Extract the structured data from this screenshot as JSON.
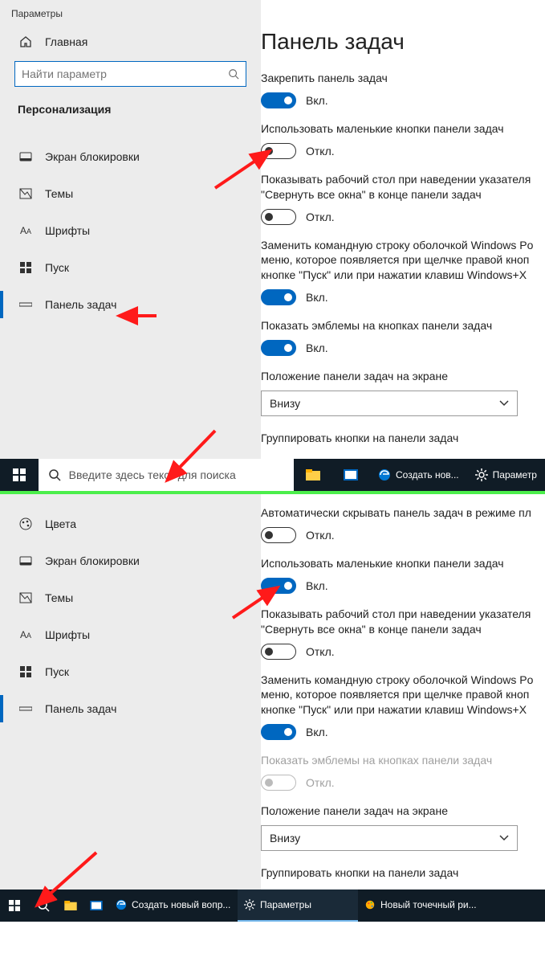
{
  "window_title": "Параметры",
  "home_label": "Главная",
  "search_placeholder": "Найти параметр",
  "section_head": "Персонализация",
  "nav": {
    "colors": "Цвета",
    "lock": "Экран блокировки",
    "themes": "Темы",
    "fonts": "Шрифты",
    "start": "Пуск",
    "taskbar": "Панель задач"
  },
  "page_title": "Панель задач",
  "labels": {
    "lock_taskbar": "Закрепить панель задач",
    "auto_hide": "Автоматически скрывать панель задач в режиме пл",
    "small_buttons": "Использовать маленькие кнопки панели задач",
    "peek": "Показывать рабочий стол при наведении указателя \"Свернуть все окна\" в конце панели задач",
    "powershell": "Заменить командную строку оболочкой Windows Po меню, которое появляется при щелчке правой кноп кнопке \"Пуск\" или при нажатии клавиш Windows+X",
    "badges": "Показать эмблемы на кнопках панели задач",
    "position": "Положение панели задач на экране",
    "group": "Группировать кнопки на панели задач"
  },
  "toggle_on": "Вкл.",
  "toggle_off": "Откл.",
  "position_value": "Внизу",
  "tb1": {
    "search_placeholder": "Введите здесь текст для поиска",
    "edge_label": "Создать нов...",
    "settings_label": "Параметр"
  },
  "tb2": {
    "edge_label": "Создать новый вопр...",
    "settings_label": "Параметры",
    "paint_label": "Новый точечный ри..."
  }
}
